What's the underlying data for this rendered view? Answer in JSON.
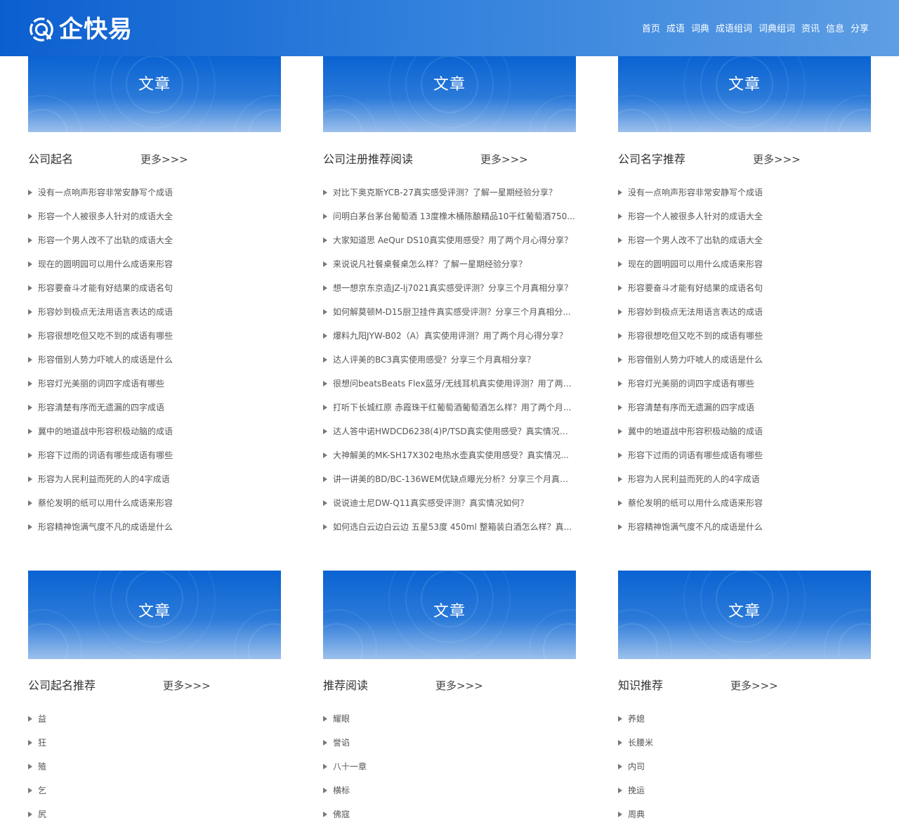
{
  "brand": {
    "name": "企快易",
    "primary": "#0c5fcf",
    "accent": "#5e9ee4"
  },
  "nav": [
    "首页",
    "成语",
    "词典",
    "成语组词",
    "词典组词",
    "资讯",
    "信息",
    "分享"
  ],
  "banner_label": "文章",
  "more_label": "更多>>>",
  "sections": [
    {
      "title": "公司起名",
      "items": [
        "没有一点响声形容非常安静写个成语",
        "形容一个人被很多人针对的成语大全",
        "形容一个男人改不了出轨的成语大全",
        "现在的圆明园可以用什么成语来形容",
        "形容要奋斗才能有好结果的成语名句",
        "形容妙到极点无法用语言表达的成语",
        "形容很想吃但又吃不到的成语有哪些",
        "形容借别人势力吓唬人的成语是什么",
        "形容灯光美丽的词四字成语有哪些",
        "形容清楚有序而无遗漏的四字成语",
        "冀中的地道战中形容积极动脑的成语",
        "形容下过雨的词语有哪些成语有哪些",
        "形容为人民利益而死的人的4字成语",
        "蔡伦发明的纸可以用什么成语来形容",
        "形容精神饱满气度不凡的成语是什么"
      ]
    },
    {
      "title": "公司注册推荐阅读",
      "items": [
        "对比下奥克斯YCB-27真实感受评测？了解一星期经验分享？",
        "问明白茅台茅台葡萄酒 13度橡木桶陈酿精品10干红葡萄酒750...",
        "大家知道思 AeQur DS10真实使用感受？用了两个月心得分享？",
        "来说说凡社餐桌餐桌怎么样？了解一星期经验分享？",
        "想一想京东京造JZ-lj7021真实感受评测？分享三个月真相分享？",
        "如何解莫顿M-D15厨卫挂件真实感受评测？分享三个月真相分...",
        "爆料九阳JYW-B02（A）真实使用评测？用了两个月心得分享？",
        "达人评美的BC3真实使用感受？分享三个月真相分享？",
        "很想问beatsBeats Flex蓝牙/无线耳机真实使用评测？用了两个...",
        "打听下长城红原 赤霞珠干红葡萄酒葡萄酒怎么样？用了两个月...",
        "达人答中诺HWDCD6238(4)P/TSD真实使用感受？真实情况如...",
        "大神解美的MK-SH17X302电热水壶真实使用感受？真实情况...",
        "讲一讲美的BD/BC-136WEM优缺点曝光分析？分享三个月真相...",
        "说说迪士尼DW-Q11真实感受评测？真实情况如何？",
        "如何选白云边白云边 五星53度 450ml 整箱装白酒怎么样？真..."
      ]
    },
    {
      "title": "公司名字推荐",
      "items": [
        "没有一点响声形容非常安静写个成语",
        "形容一个人被很多人针对的成语大全",
        "形容一个男人改不了出轨的成语大全",
        "现在的圆明园可以用什么成语来形容",
        "形容要奋斗才能有好结果的成语名句",
        "形容妙到极点无法用语言表达的成语",
        "形容很想吃但又吃不到的成语有哪些",
        "形容借别人势力吓唬人的成语是什么",
        "形容灯光美丽的词四字成语有哪些",
        "形容清楚有序而无遗漏的四字成语",
        "冀中的地道战中形容积极动脑的成语",
        "形容下过雨的词语有哪些成语有哪些",
        "形容为人民利益而死的人的4字成语",
        "蔡伦发明的纸可以用什么成语来形容",
        "形容精神饱满气度不凡的成语是什么"
      ]
    },
    {
      "title": "公司起名推荐",
      "items": [
        "益",
        "狂",
        "殖",
        "乞",
        "尻"
      ]
    },
    {
      "title": "推荐阅读",
      "items": [
        "耀眼",
        "誉谄",
        "八十一章",
        "横标",
        "佛寇"
      ]
    },
    {
      "title": "知识推荐",
      "items": [
        "养媳",
        "长腰米",
        "内司",
        "挽运",
        "周典"
      ]
    }
  ]
}
